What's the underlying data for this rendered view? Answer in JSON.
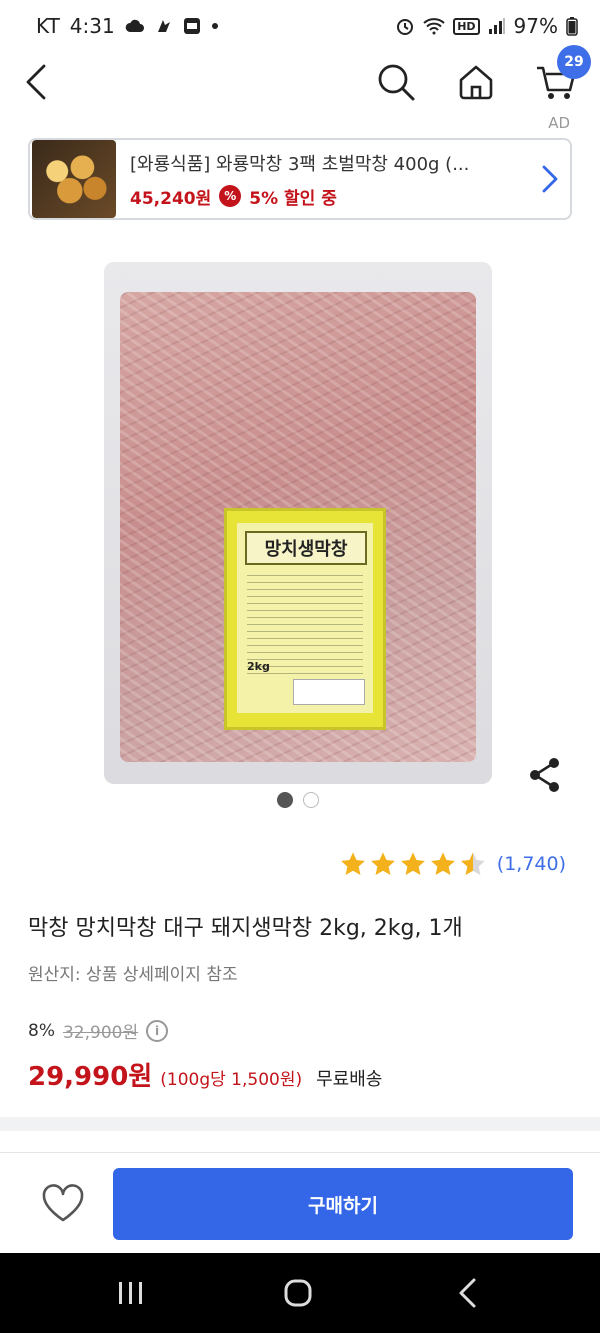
{
  "status_bar": {
    "carrier": "KT",
    "time": "4:31",
    "battery": "97%",
    "hd_badge": "HD",
    "icons": [
      "cloud-icon",
      "app-icon",
      "blog-icon",
      "dot-icon",
      "alarm-icon",
      "wifi-icon",
      "signal-icon",
      "battery-icon"
    ]
  },
  "nav": {
    "cart_count": "29",
    "icons": [
      "back-icon",
      "search-icon",
      "home-icon",
      "cart-icon"
    ]
  },
  "ad": {
    "label": "AD",
    "title": "[와룡식품] 와룡막창 3팩 초벌막창 400g (...",
    "price": "45,240원",
    "discount_symbol": "%",
    "discount_text": "5% 할인 중"
  },
  "product_image": {
    "label_text": "망치생막창",
    "weight_text": "2kg"
  },
  "rating": {
    "stars": 4.5,
    "count": "(1,740)"
  },
  "product": {
    "title": "막창 망치막창 대구 돼지생막창 2kg, 2kg, 1개",
    "origin": "원산지: 상품 상세페이지 참조",
    "discount_rate": "8%",
    "original_price": "32,900원",
    "info_symbol": "i",
    "sale_price": "29,990원",
    "unit_price": "(100g당 1,500원)",
    "shipping": "무료배송"
  },
  "bottom": {
    "buy_label": "구매하기"
  },
  "colors": {
    "accent_blue": "#3466e8",
    "price_red": "#c4141b",
    "star_gold": "#f3b21b"
  }
}
